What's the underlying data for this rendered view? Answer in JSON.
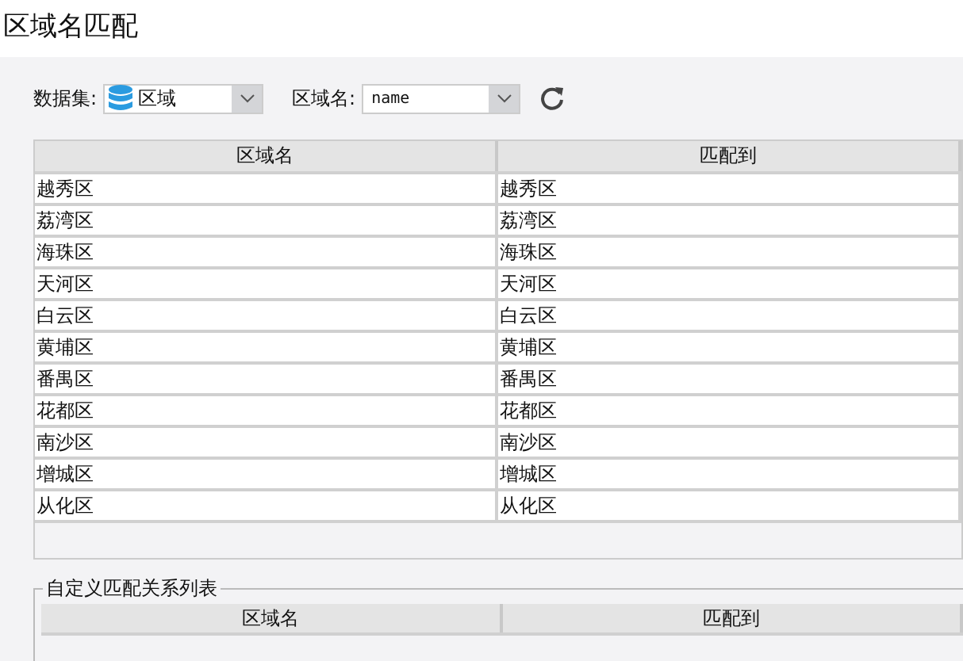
{
  "window": {
    "title": "区域名匹配"
  },
  "toolbar": {
    "dataset_label": "数据集:",
    "dataset_value": "区域",
    "field_label": "区域名:",
    "field_value": "name"
  },
  "table": {
    "columns": [
      "区域名",
      "匹配到"
    ],
    "rows": [
      [
        "越秀区",
        "越秀区"
      ],
      [
        "荔湾区",
        "荔湾区"
      ],
      [
        "海珠区",
        "海珠区"
      ],
      [
        "天河区",
        "天河区"
      ],
      [
        "白云区",
        "白云区"
      ],
      [
        "黄埔区",
        "黄埔区"
      ],
      [
        "番禺区",
        "番禺区"
      ],
      [
        "花都区",
        "花都区"
      ],
      [
        "南沙区",
        "南沙区"
      ],
      [
        "增城区",
        "增城区"
      ],
      [
        "从化区",
        "从化区"
      ]
    ]
  },
  "custom_group": {
    "title": "自定义匹配关系列表",
    "columns": [
      "区域名",
      "匹配到"
    ]
  }
}
